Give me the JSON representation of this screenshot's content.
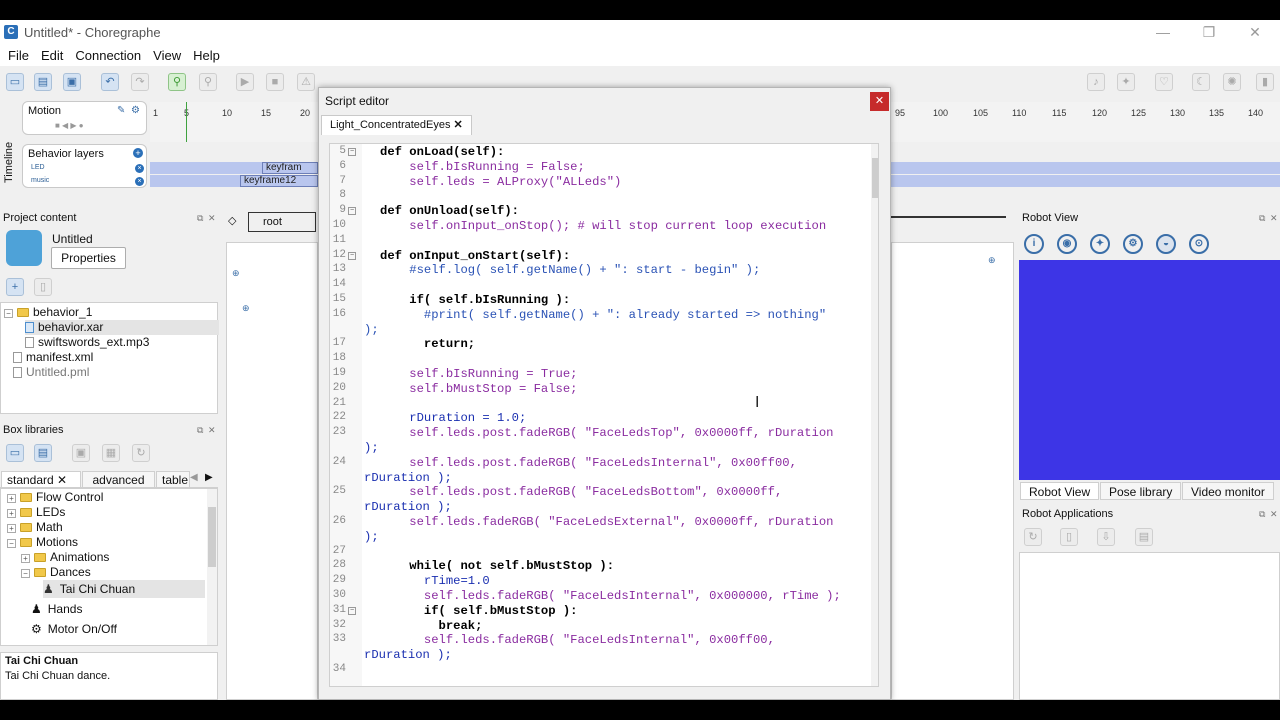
{
  "window": {
    "title": "Untitled* - Choregraphe",
    "icon": "C",
    "minimize": "—",
    "restore": "❐",
    "close": "✕"
  },
  "menu": [
    "File",
    "Edit",
    "Connection",
    "View",
    "Help"
  ],
  "timeline": {
    "side_label": "Timeline",
    "motion_label": "Motion",
    "behavior_layers_label": "Behavior layers",
    "layers": [
      "LED",
      "music"
    ],
    "keyframes": [
      "keyfram",
      "keyframe12"
    ],
    "ruler_left": [
      "1",
      "5",
      "10",
      "15",
      "20"
    ],
    "ruler_right": [
      "95",
      "100",
      "105",
      "110",
      "115",
      "120",
      "125",
      "130",
      "135",
      "140"
    ]
  },
  "project": {
    "title": "Project content",
    "name": "Untitled",
    "properties_button": "Properties",
    "items": [
      "behavior_1",
      "behavior.xar",
      "swiftswords_ext.mp3",
      "manifest.xml",
      "Untitled.pml"
    ]
  },
  "breadcrumb": {
    "root": "root"
  },
  "box_libraries": {
    "title": "Box libraries",
    "tabs": [
      "standard",
      "advanced",
      "table"
    ],
    "tree": [
      "Flow Control",
      "LEDs",
      "Math",
      "Motions",
      "Animations",
      "Dances",
      "Tai Chi Chuan",
      "Hands",
      "Motor On/Off"
    ],
    "selected_name": "Tai Chi Chuan",
    "selected_desc": "Tai Chi Chuan dance."
  },
  "script_editor": {
    "title": "Script editor",
    "close": "✕",
    "tab": "Light_ConcentratedEyes",
    "lines": [
      {
        "n": "5",
        "fold": true,
        "t": "def onLoad(self):",
        "c": "kw"
      },
      {
        "n": "6",
        "t": "    self.bIsRunning = False;",
        "c": "self"
      },
      {
        "n": "7",
        "t": "    self.leds = ALProxy(\"ALLeds\")",
        "c": "self"
      },
      {
        "n": "8",
        "t": "",
        "c": ""
      },
      {
        "n": "9",
        "fold": true,
        "t": "def onUnload(self):",
        "c": "kw"
      },
      {
        "n": "10",
        "t": "    self.onInput_onStop(); # will stop current loop execution",
        "c": "self"
      },
      {
        "n": "11",
        "t": "",
        "c": ""
      },
      {
        "n": "12",
        "fold": true,
        "t": "def onInput_onStart(self):",
        "c": "kw"
      },
      {
        "n": "13",
        "t": "    #self.log( self.getName() + \": start - begin\" );",
        "c": "cm"
      },
      {
        "n": "14",
        "t": "",
        "c": ""
      },
      {
        "n": "15",
        "t": "    if( self.bIsRunning ):",
        "c": "kw"
      },
      {
        "n": "16",
        "t": "      #print( self.getName() + \": already started => nothing\"",
        "c": "cm"
      },
      {
        "n": "",
        "t": ");",
        "c": "cm",
        "wrap": true
      },
      {
        "n": "17",
        "t": "      return;",
        "c": "kw"
      },
      {
        "n": "18",
        "t": "",
        "c": ""
      },
      {
        "n": "19",
        "t": "    self.bIsRunning = True;",
        "c": "self"
      },
      {
        "n": "20",
        "t": "    self.bMustStop = False;",
        "c": "self"
      },
      {
        "n": "21",
        "t": "",
        "c": ""
      },
      {
        "n": "22",
        "t": "    rDuration = 1.0;",
        "c": "txt"
      },
      {
        "n": "23",
        "t": "    self.leds.post.fadeRGB( \"FaceLedsTop\", 0x0000ff, rDuration",
        "c": "self"
      },
      {
        "n": "",
        "t": ");",
        "c": "txt",
        "wrap": true
      },
      {
        "n": "24",
        "t": "    self.leds.post.fadeRGB( \"FaceLedsInternal\", 0x00ff00,",
        "c": "self"
      },
      {
        "n": "",
        "t": "rDuration );",
        "c": "txt",
        "wrap": true
      },
      {
        "n": "25",
        "t": "    self.leds.post.fadeRGB( \"FaceLedsBottom\", 0x0000ff,",
        "c": "self"
      },
      {
        "n": "",
        "t": "rDuration );",
        "c": "txt",
        "wrap": true
      },
      {
        "n": "26",
        "t": "    self.leds.fadeRGB( \"FaceLedsExternal\", 0x0000ff, rDuration",
        "c": "self"
      },
      {
        "n": "",
        "t": ");",
        "c": "txt",
        "wrap": true
      },
      {
        "n": "27",
        "t": "",
        "c": ""
      },
      {
        "n": "28",
        "t": "    while( not self.bMustStop ):",
        "c": "kw"
      },
      {
        "n": "29",
        "t": "      rTime=1.0",
        "c": "txt"
      },
      {
        "n": "30",
        "t": "      self.leds.fadeRGB( \"FaceLedsInternal\", 0x000000, rTime );",
        "c": "self"
      },
      {
        "n": "31",
        "fold": true,
        "t": "      if( self.bMustStop ):",
        "c": "kw"
      },
      {
        "n": "32",
        "t": "        break;",
        "c": "kw"
      },
      {
        "n": "33",
        "t": "      self.leds.fadeRGB( \"FaceLedsInternal\", 0x00ff00,",
        "c": "self"
      },
      {
        "n": "",
        "t": "rDuration );",
        "c": "txt",
        "wrap": true
      },
      {
        "n": "34",
        "t": "",
        "c": ""
      }
    ]
  },
  "robot_view": {
    "title": "Robot View",
    "tabs": [
      "Robot View",
      "Pose library",
      "Video monitor"
    ],
    "color": "#3d35e6"
  },
  "robot_apps": {
    "title": "Robot Applications"
  }
}
